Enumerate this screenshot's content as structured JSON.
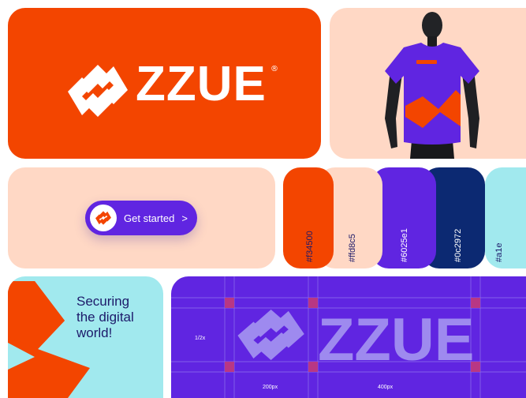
{
  "brand": {
    "name": "ZZUE",
    "registered": "®",
    "primary_color": "#f34500",
    "secondary_color": "#6025e1"
  },
  "button": {
    "label": "Get started",
    "chevron": ">"
  },
  "tagline": {
    "line1": "Securing",
    "line2": "the digital",
    "line3": "world!"
  },
  "palette": [
    {
      "hex_label": "#f34500",
      "color": "#f34500",
      "text_color": "#1d1a6a"
    },
    {
      "hex_label": "#ffd8c5",
      "color": "#ffd8c5",
      "text_color": "#1d1a6a"
    },
    {
      "hex_label": "#6025e1",
      "color": "#6025e1",
      "text_color": "#ffffff"
    },
    {
      "hex_label": "#0c2972",
      "color": "#0c2972",
      "text_color": "#ffffff"
    },
    {
      "hex_label": "#a1e",
      "color": "#a1e9ee",
      "text_color": "#1d1a6a"
    }
  ],
  "grid": {
    "label_ratio": "1/2x",
    "label_200": "200px",
    "label_400": "400px",
    "wordmark": "ZZUE"
  },
  "colors": {
    "peach": "#ffd8c5",
    "cyan": "#a1e9ee",
    "navy": "#0c2972"
  }
}
